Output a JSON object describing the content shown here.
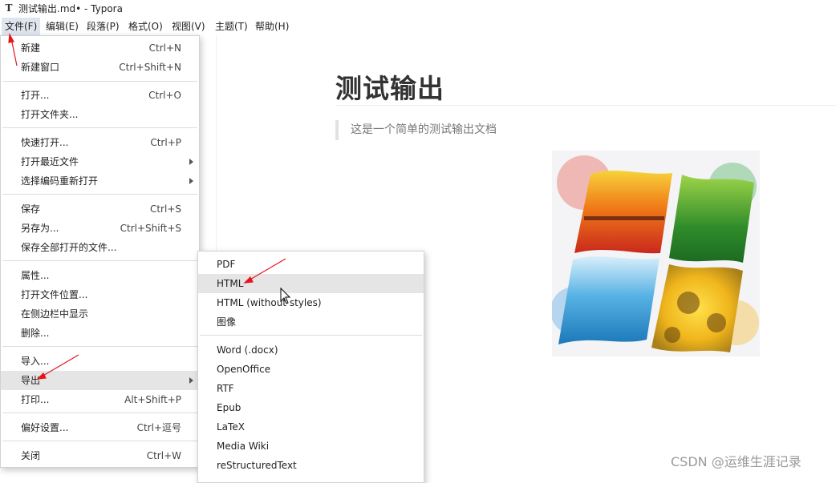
{
  "window": {
    "title": "测试输出.md• - Typora",
    "icon_letter": "T"
  },
  "menubar": [
    {
      "label": "文件(F)",
      "active": true
    },
    {
      "label": "编辑(E)"
    },
    {
      "label": "段落(P)"
    },
    {
      "label": "格式(O)"
    },
    {
      "label": "视图(V)"
    },
    {
      "label": "主题(T)"
    },
    {
      "label": "帮助(H)"
    }
  ],
  "file_menu": {
    "items": [
      {
        "label": "新建",
        "shortcut": "Ctrl+N"
      },
      {
        "label": "新建窗口",
        "shortcut": "Ctrl+Shift+N"
      },
      {
        "label": "打开...",
        "shortcut": "Ctrl+O"
      },
      {
        "label": "打开文件夹..."
      },
      {
        "label": "快速打开...",
        "shortcut": "Ctrl+P"
      },
      {
        "label": "打开最近文件",
        "submenu": true
      },
      {
        "label": "选择编码重新打开",
        "submenu": true
      },
      {
        "label": "保存",
        "shortcut": "Ctrl+S"
      },
      {
        "label": "另存为...",
        "shortcut": "Ctrl+Shift+S"
      },
      {
        "label": "保存全部打开的文件..."
      },
      {
        "label": "属性..."
      },
      {
        "label": "打开文件位置..."
      },
      {
        "label": "在侧边栏中显示"
      },
      {
        "label": "删除..."
      },
      {
        "label": "导入..."
      },
      {
        "label": "导出",
        "submenu": true,
        "highlighted": true
      },
      {
        "label": "打印...",
        "shortcut": "Alt+Shift+P"
      },
      {
        "label": "偏好设置...",
        "shortcut": "Ctrl+逗号"
      },
      {
        "label": "关闭",
        "shortcut": "Ctrl+W"
      }
    ]
  },
  "export_submenu": {
    "items": [
      {
        "label": "PDF"
      },
      {
        "label": "HTML",
        "highlighted": true
      },
      {
        "label": "HTML (without styles)"
      },
      {
        "label": "图像"
      },
      {
        "label": "Word (.docx)"
      },
      {
        "label": "OpenOffice"
      },
      {
        "label": "RTF"
      },
      {
        "label": "Epub"
      },
      {
        "label": "LaTeX"
      },
      {
        "label": "Media Wiki"
      },
      {
        "label": "reStructuredText"
      }
    ]
  },
  "document": {
    "heading": "测试输出",
    "blockquote": "这是一个简单的测试输出文档"
  },
  "watermark": "CSDN @运维生涯记录",
  "colors": {
    "annotation_arrow": "#e8141b",
    "menu_hover": "#e5e5e5",
    "menubar_active": "#dfe5ee"
  }
}
